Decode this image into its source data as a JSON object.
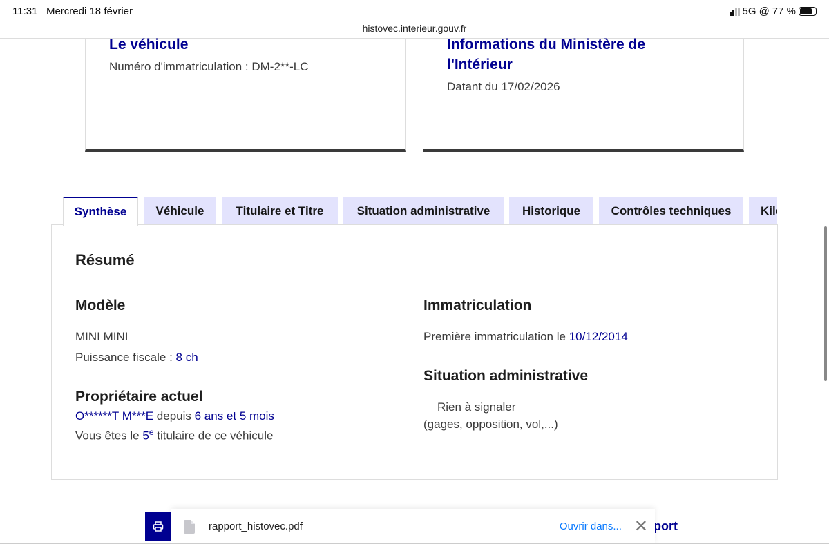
{
  "status_bar": {
    "time": "11:31",
    "date": "Mercredi 18 février",
    "network": "5G",
    "battery": "77 %"
  },
  "url": "histovec.interieur.gouv.fr",
  "card_vehicle": {
    "title": "Le véhicule",
    "plate_label": "Numéro d'immatriculation : DM-2**-LC"
  },
  "card_ministry": {
    "title": "Informations du Ministère de l'Intérieur",
    "date": "Datant du 17/02/2026"
  },
  "tabs": [
    {
      "label": "Synthèse"
    },
    {
      "label": "Véhicule"
    },
    {
      "label": "Titulaire et Titre"
    },
    {
      "label": "Situation administrative"
    },
    {
      "label": "Historique"
    },
    {
      "label": "Contrôles techniques"
    },
    {
      "label": "Kilométrage"
    }
  ],
  "summary": {
    "title": "Résumé",
    "model": {
      "heading": "Modèle",
      "name": "MINI MINI",
      "power_label": "Puissance fiscale : ",
      "power": "8 ch"
    },
    "owner": {
      "heading": "Propriétaire actuel",
      "name": "O******T M***E",
      "since_label": " depuis ",
      "since": "6 ans et 5 mois",
      "rank_prefix": "Vous êtes le ",
      "rank": "5",
      "rank_sup": "e",
      "rank_suffix": " titulaire de ce véhicule"
    },
    "registration": {
      "heading": "Immatriculation",
      "first_label": "Première immatriculation le ",
      "first_date": "10/12/2014"
    },
    "admin": {
      "heading": "Situation administrative",
      "status": "Rien à signaler",
      "detail": "(gages, opposition, vol,...)"
    }
  },
  "download_bar": {
    "filename": "rapport_histovec.pdf",
    "open_label": "Ouvrir dans...",
    "report_button": "Rapport"
  }
}
